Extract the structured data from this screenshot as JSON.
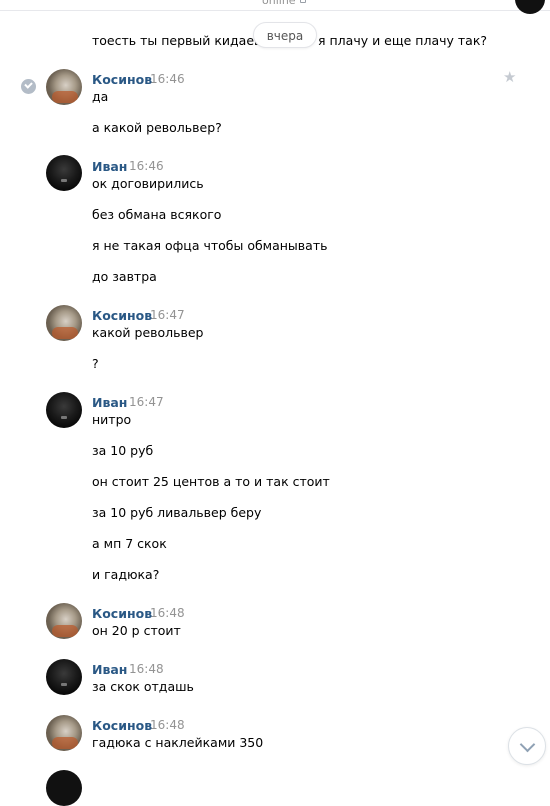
{
  "header": {
    "status": "online",
    "date_divider": "вчера"
  },
  "top_message": {
    "text_left": "тоесть ты первый кидаешь",
    "text_right": "я плачу и еще плачу так?"
  },
  "groups": [
    {
      "author": "Косинов",
      "time": "16:46",
      "avatar": "cat",
      "messages": [
        "да",
        "а какой револьвер?"
      ]
    },
    {
      "author": "Иван",
      "time": "16:46",
      "avatar": "dark",
      "messages": [
        "ок договирились",
        "без обмана всякого",
        "я не такая офца чтобы обманывать",
        "до завтра"
      ]
    },
    {
      "author": "Косинов",
      "time": "16:47",
      "avatar": "cat",
      "messages": [
        "какой револьвер",
        "?"
      ]
    },
    {
      "author": "Иван",
      "time": "16:47",
      "avatar": "dark",
      "messages": [
        "нитро",
        "за 10 руб",
        "он стоит 25 центов а то и так стоит",
        "за 10 руб ливальвер беру",
        "а мп 7 скок",
        "и гадюка?"
      ]
    },
    {
      "author": "Косинов",
      "time": "16:48",
      "avatar": "cat",
      "messages": [
        "он 20 р стоит"
      ]
    },
    {
      "author": "Иван",
      "time": "16:48",
      "avatar": "dark",
      "messages": [
        "за скок отдашь"
      ]
    },
    {
      "author": "Косинов",
      "time": "16:48",
      "avatar": "cat",
      "messages": [
        "гадюка с наклейками 350"
      ]
    }
  ],
  "icons": {
    "selected_check": "check-circle-icon",
    "favorite": "star-icon",
    "scroll_down": "chevron-down-icon",
    "phone": "phone-icon"
  },
  "colors": {
    "author_link": "#2a5885",
    "timestamp": "#939393"
  }
}
